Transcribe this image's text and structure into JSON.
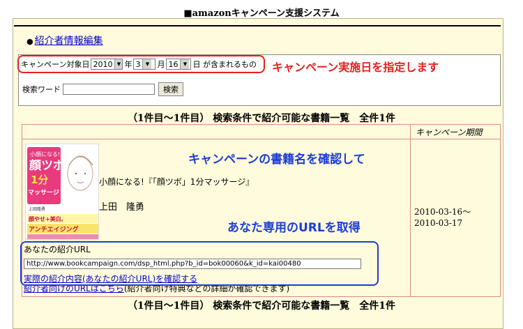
{
  "header": {
    "system_title": "■amazonキャンペーン支援システム"
  },
  "nav": {
    "bullet": "●",
    "edit_link": "紹介者情報編集"
  },
  "search": {
    "date_label": "キャンペーン対象日",
    "year_value": "2010",
    "year_unit": "年",
    "month_value": "3",
    "month_unit": "月",
    "day_value": "16",
    "day_suffix": "日 が含まれるもの",
    "keyword_label": "検索ワード",
    "keyword_value": "",
    "search_button": "検索"
  },
  "annotations": {
    "date_note": "キャンペーン実施日を指定します",
    "book_note": "キャンペーンの書籍名を確認して",
    "url_note": "あなた専用のURLを取得"
  },
  "results": {
    "summary_top": "（1件目〜1件目） 検索条件で紹介可能な書籍一覧　全件1件",
    "summary_bottom": "（1件目〜1件目） 検索条件で紹介可能な書籍一覧　全件1件",
    "col_period": "キャンペーン期間"
  },
  "book": {
    "title": "小顔になる!『「顔ツボ」1分マッサージ』",
    "author": "上田　隆勇",
    "cover_line1": "小顔になる!",
    "cover_line2": "顔ツボ",
    "cover_line3": "1分",
    "cover_line4": "マッサージ",
    "cover_author": "上田隆勇",
    "cover_band1": "顔やせ+美白,",
    "cover_band2": "アンチエイジング",
    "period_start": "2010-03-16〜",
    "period_end": "2010-03-17"
  },
  "referral": {
    "url_label": "あなたの紹介URL",
    "url_value": "http://www.bookcampaign.com/dsp_html.php?b_id=bok00060&k_id=kai00480",
    "confirm_link": "実際の紹介内容(あなたの紹介URL)を確認する",
    "referrer_link": "紹介者向けのURLはこちら",
    "referrer_note": "(紹介者向け特典などの詳細が確認できます)"
  },
  "colors": {
    "red_annotation": "#e8201c",
    "blue_annotation": "#1c3dd8",
    "panel_bg": "#fffbdc",
    "link": "#0000cc"
  }
}
